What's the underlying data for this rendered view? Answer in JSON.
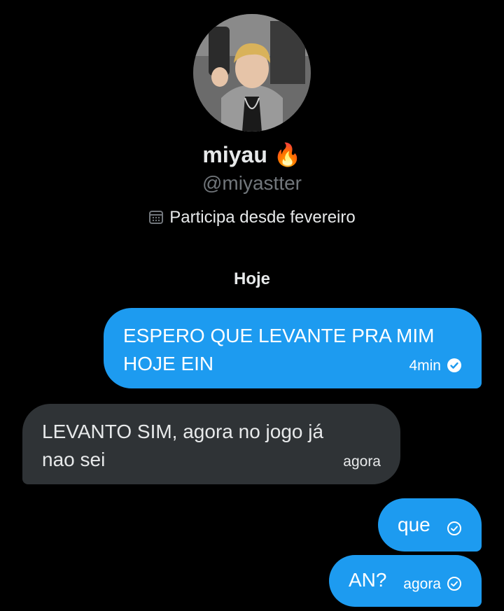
{
  "profile": {
    "display_name": "miyau",
    "emoji": "🔥",
    "handle": "@miyastter",
    "joined": "Participa desde fevereiro",
    "icons": {
      "calendar": "calendar-icon"
    }
  },
  "conversation": {
    "day_separator": "Hoje",
    "messages": [
      {
        "direction": "outgoing",
        "text_line1": "ESPERO QUE LEVANTE PRA MIM",
        "text_line2": "HOJE EIN",
        "time": "4min",
        "status": "read"
      },
      {
        "direction": "incoming",
        "text_line1": "LEVANTO SIM, agora no jogo já",
        "text_line2": "nao sei",
        "time": "agora"
      },
      {
        "direction": "outgoing",
        "text": "que",
        "time": "",
        "status": "sent"
      },
      {
        "direction": "outgoing",
        "text": "AN?",
        "time": "agora",
        "status": "sent"
      }
    ]
  },
  "colors": {
    "background": "#000000",
    "outgoing_bubble": "#1d9bf0",
    "incoming_bubble": "#2f3336",
    "secondary_text": "#71767b"
  }
}
